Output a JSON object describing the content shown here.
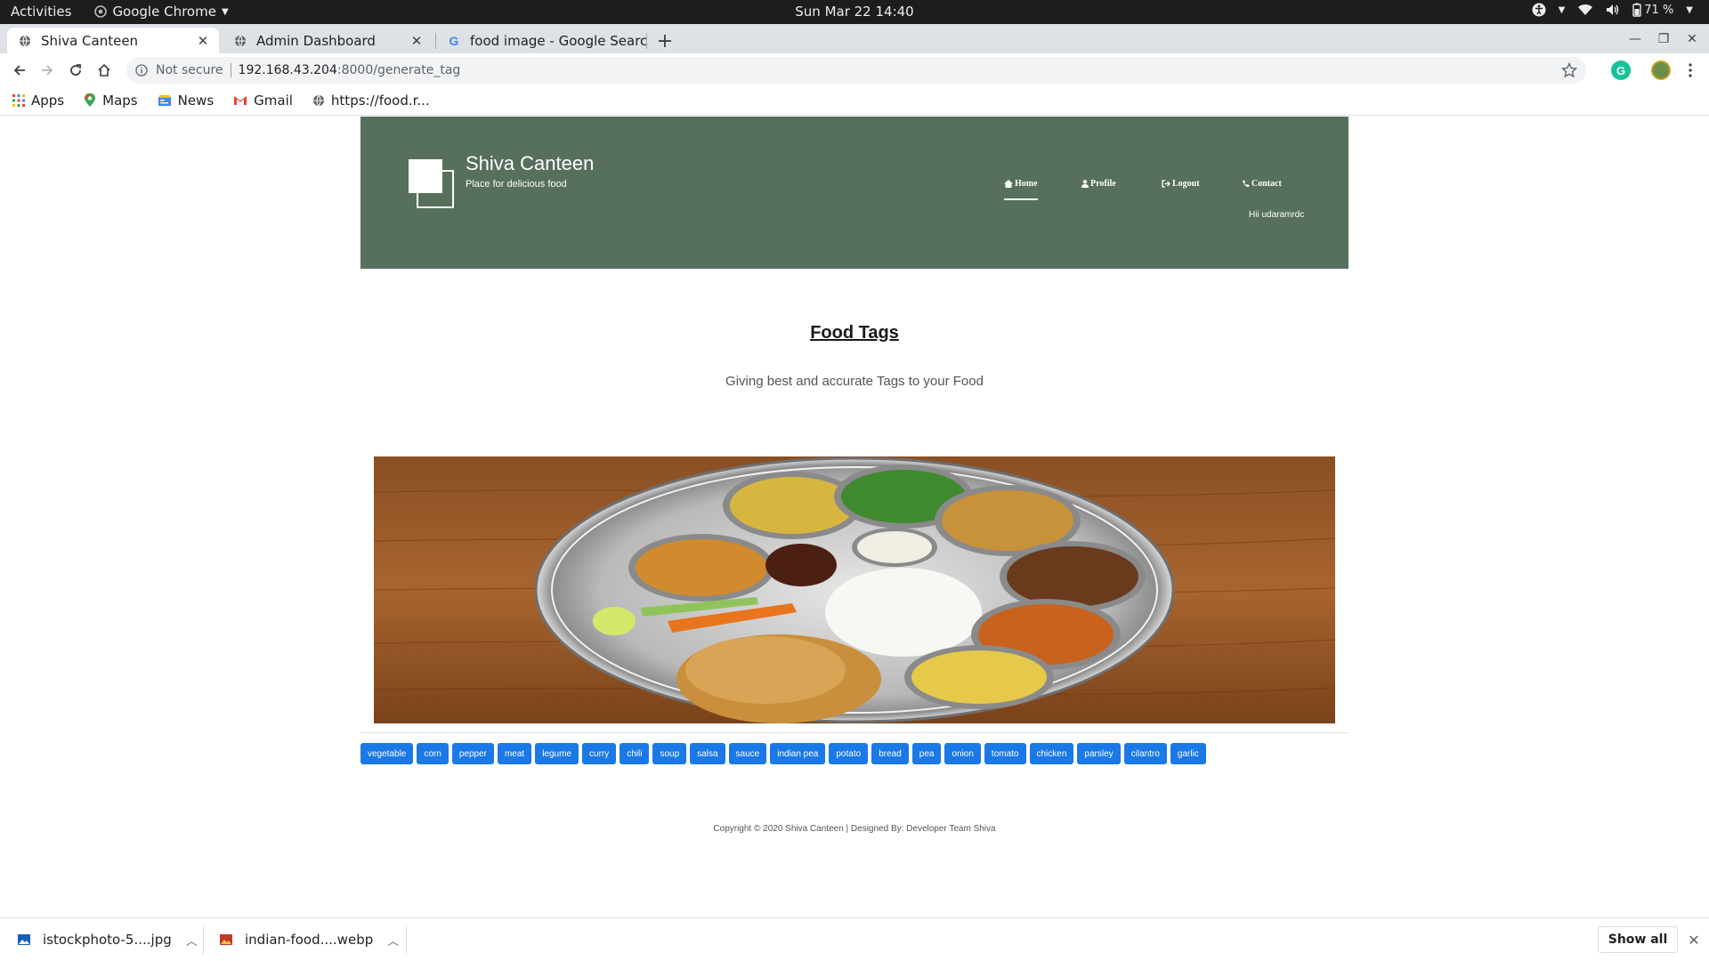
{
  "system_bar": {
    "activities": "Activities",
    "app_name": "Google Chrome",
    "clock": "Sun Mar 22  14:40",
    "battery": "71 %"
  },
  "tabs": [
    {
      "title": "Shiva Canteen",
      "active": true,
      "icon": "globe-icon"
    },
    {
      "title": "Admin Dashboard",
      "active": false,
      "icon": "globe-icon"
    },
    {
      "title": "food image - Google Search",
      "active": false,
      "icon": "google-icon"
    }
  ],
  "omnibox": {
    "security_label": "Not secure",
    "url_host": "192.168.43.204",
    "url_path": ":8000/generate_tag"
  },
  "bookmarks": [
    {
      "label": "Apps",
      "icon": "apps-grid-icon"
    },
    {
      "label": "Maps",
      "icon": "maps-icon"
    },
    {
      "label": "News",
      "icon": "news-icon"
    },
    {
      "label": "Gmail",
      "icon": "gmail-icon"
    },
    {
      "label": "https://food.r...",
      "icon": "globe-icon"
    }
  ],
  "site": {
    "brand_name": "Shiva Canteen",
    "brand_tagline": "Place for delicious food",
    "nav": {
      "home": "Home",
      "profile": "Profile",
      "logout": "Logout",
      "contact": "Contact"
    },
    "greeting": "Hii udaramrdc",
    "header_color": "#56705d"
  },
  "main": {
    "title": "Food Tags",
    "subtitle": "Giving best and accurate Tags to your Food",
    "image_alt": "Indian thali on wooden table",
    "tags": [
      "vegetable",
      "corn",
      "pepper",
      "meat",
      "legume",
      "curry",
      "chili",
      "soup",
      "salsa",
      "sauce",
      "indian pea",
      "potato",
      "bread",
      "pea",
      "onion",
      "tomato",
      "chicken",
      "parsley",
      "cilantro",
      "garlic"
    ],
    "tag_color": "#1a79e6"
  },
  "footer": {
    "copyright": "Copyright © 2020 Shiva Canteen | Designed By: Developer Team Shiva"
  },
  "downloads": {
    "items": [
      {
        "name": "istockphoto-5....jpg"
      },
      {
        "name": "indian-food....webp"
      }
    ],
    "show_all_label": "Show all"
  }
}
